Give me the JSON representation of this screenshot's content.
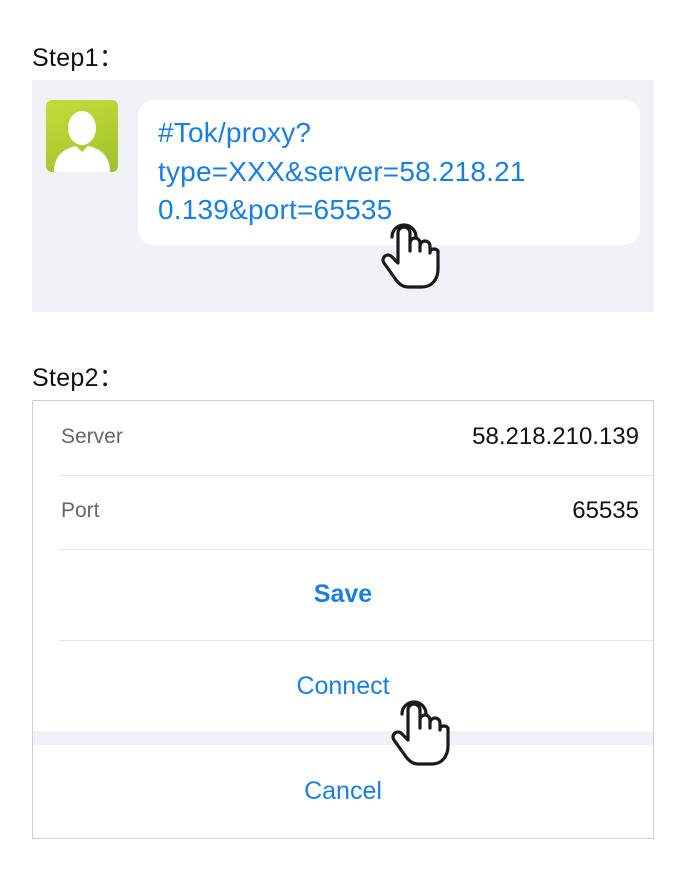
{
  "step1": {
    "label": "Step1：",
    "message_lines": [
      "#Tok/proxy?",
      "type=XXX&server=58.218.21",
      "0.139&port=65535"
    ]
  },
  "step2": {
    "label": "Step2：",
    "fields": [
      {
        "label": "Server",
        "value": "58.218.210.139"
      },
      {
        "label": "Port",
        "value": "65535"
      }
    ],
    "save_label": "Save",
    "connect_label": "Connect",
    "cancel_label": "Cancel"
  },
  "icons": {
    "avatar": "default-user-avatar-icon",
    "tap_hand": "tap-hand-icon"
  },
  "colors": {
    "link_blue": "#1a7fe0",
    "panel_bg": "#f1f2f7",
    "avatar_green": "#b5d233"
  }
}
